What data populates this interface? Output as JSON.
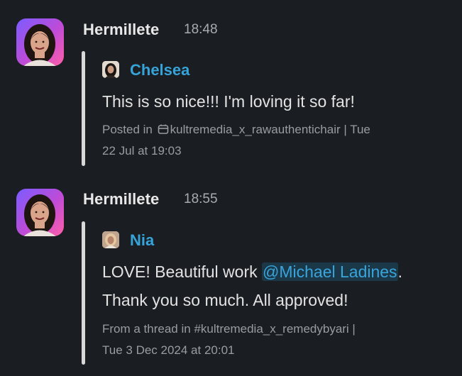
{
  "messages": [
    {
      "sender": "Hermillete",
      "time": "18:48",
      "quote": {
        "author": "Chelsea",
        "text": "This is so nice!!! I'm loving it so far!",
        "meta_prefix": "Posted in ",
        "channel": "kultremedia_x_rawauthentichair",
        "meta_suffix_line1": " | Tue",
        "meta_line2": "22 Jul at 19:03"
      }
    },
    {
      "sender": "Hermillete",
      "time": "18:55",
      "quote": {
        "author": "Nia",
        "text_line1_before": "LOVE! Beautiful work ",
        "mention": "@Michael Ladines",
        "text_line1_after": ".",
        "text_line2": "Thank you so much. All approved!",
        "meta_line1": "From a thread in #kultremedia_x_remedybyari |",
        "meta_line2": "Tue 3 Dec 2024 at 20:01"
      }
    }
  ],
  "icons": {
    "sender_avatar": "user-avatar-photo",
    "quote_avatar": "user-avatar-thumbnail",
    "channel": "shared-channel-icon"
  },
  "colors": {
    "background": "#1a1d21",
    "author_link": "#36a3d9",
    "mention": "#3aa4dc",
    "quote_bar": "#d8d8d8"
  }
}
